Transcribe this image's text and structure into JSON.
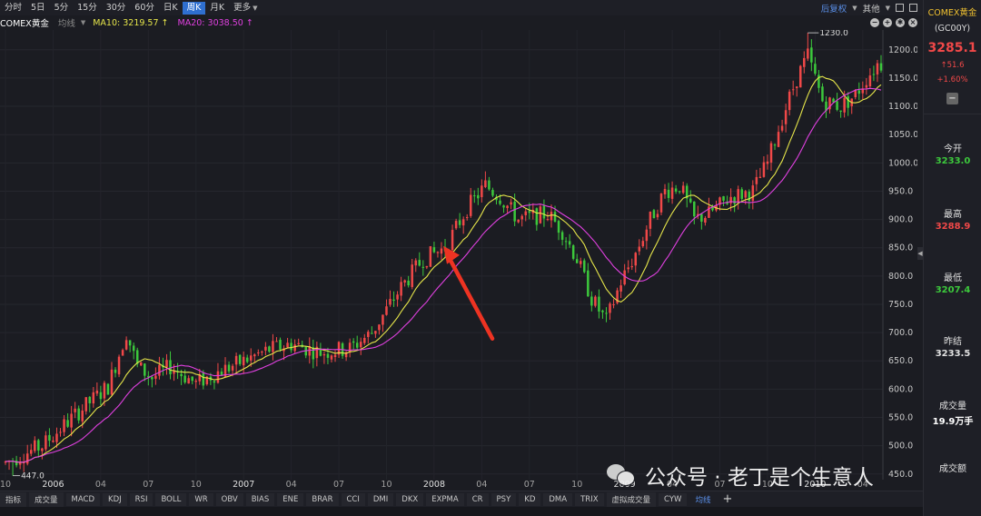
{
  "toolbar": {
    "periods": [
      "分时",
      "5日",
      "5分",
      "15分",
      "30分",
      "60分",
      "日K",
      "周K",
      "月K",
      "更多"
    ],
    "active_period": "周K",
    "adjust": "后复权",
    "other": "其他"
  },
  "legend": {
    "symbol": "COMEX黄金",
    "ma_label": "均线",
    "ma10": "MA10: 3219.57 ↑",
    "ma20": "MA20: 3038.50 ↑"
  },
  "colors": {
    "up": "#f04848",
    "down": "#3cc83c",
    "ma10": "#e6e64a",
    "ma20": "#e040e0",
    "bg": "#1b1c22",
    "arrow": "#ee3322"
  },
  "chart_data": {
    "type": "candlestick",
    "ylim": [
      440,
      1235
    ],
    "y_ticks": [
      "1200.0",
      "1150.0",
      "1100.0",
      "1050.0",
      "1000.0",
      "950.0",
      "900.0",
      "850.0",
      "800.0",
      "750.0",
      "700.0",
      "650.0",
      "600.0",
      "550.0",
      "500.0",
      "450.0"
    ],
    "y_tick_values": [
      1200,
      1150,
      1100,
      1050,
      1000,
      950,
      900,
      850,
      800,
      750,
      700,
      650,
      600,
      550,
      500,
      450
    ],
    "x_ticks": [
      "10",
      "2006",
      "04",
      "07",
      "10",
      "2007",
      "04",
      "07",
      "10",
      "2008",
      "04",
      "07",
      "10",
      "2009",
      "04",
      "07",
      "10",
      "2010",
      "04"
    ],
    "x_tick_weeks": [
      0,
      13,
      26,
      39,
      52,
      65,
      78,
      91,
      104,
      117,
      130,
      143,
      156,
      169,
      182,
      195,
      208,
      221,
      234
    ],
    "low_annotation": "447.0",
    "low_value": 447.0,
    "high_annotation": "1230.0",
    "high_value": 1230.0,
    "anchors": [
      [
        0,
        470
      ],
      [
        10,
        500
      ],
      [
        20,
        560
      ],
      [
        28,
        605
      ],
      [
        33,
        700
      ],
      [
        36,
        640
      ],
      [
        40,
        620
      ],
      [
        45,
        640
      ],
      [
        52,
        610
      ],
      [
        58,
        630
      ],
      [
        65,
        650
      ],
      [
        72,
        670
      ],
      [
        78,
        680
      ],
      [
        86,
        665
      ],
      [
        94,
        672
      ],
      [
        100,
        700
      ],
      [
        108,
        780
      ],
      [
        114,
        830
      ],
      [
        120,
        850
      ],
      [
        126,
        920
      ],
      [
        131,
        960
      ],
      [
        135,
        940
      ],
      [
        140,
        900
      ],
      [
        148,
        910
      ],
      [
        152,
        880
      ],
      [
        156,
        830
      ],
      [
        160,
        760
      ],
      [
        164,
        720
      ],
      [
        168,
        790
      ],
      [
        172,
        840
      ],
      [
        176,
        900
      ],
      [
        180,
        950
      ],
      [
        184,
        960
      ],
      [
        188,
        900
      ],
      [
        192,
        910
      ],
      [
        198,
        940
      ],
      [
        204,
        950
      ],
      [
        208,
        1000
      ],
      [
        212,
        1080
      ],
      [
        216,
        1150
      ],
      [
        219,
        1190
      ],
      [
        223,
        1110
      ],
      [
        228,
        1100
      ],
      [
        232,
        1120
      ],
      [
        235,
        1150
      ],
      [
        238,
        1175
      ]
    ]
  },
  "indicators": [
    "指标",
    "成交量",
    "MACD",
    "KDJ",
    "RSI",
    "BOLL",
    "WR",
    "OBV",
    "BIAS",
    "ENE",
    "BRAR",
    "CCI",
    "DMI",
    "DKX",
    "EXPMA",
    "CR",
    "PSY",
    "KD",
    "DMA",
    "TRIX",
    "虚拟成交量",
    "CYW",
    "均线"
  ],
  "active_indicator": "均线",
  "panel": {
    "title": "COMEX黄金",
    "code": "(GC00Y)",
    "price": "3285.1",
    "change": "↑51.6",
    "percent": "+1.60%",
    "stats": [
      {
        "label": "今开",
        "value": "3233.0",
        "color": "#3cc83c"
      },
      {
        "label": "最高",
        "value": "3288.9",
        "color": "#f04848"
      },
      {
        "label": "最低",
        "value": "3207.4",
        "color": "#3cc83c"
      },
      {
        "label": "昨结",
        "value": "3233.5",
        "color": "#e0e0e0"
      },
      {
        "label": "成交量",
        "value": "19.9万手",
        "color": "#ffffff"
      },
      {
        "label": "成交额",
        "value": "",
        "color": "#ffffff"
      }
    ]
  },
  "watermark": "公众号 · 老丁是个生意人"
}
